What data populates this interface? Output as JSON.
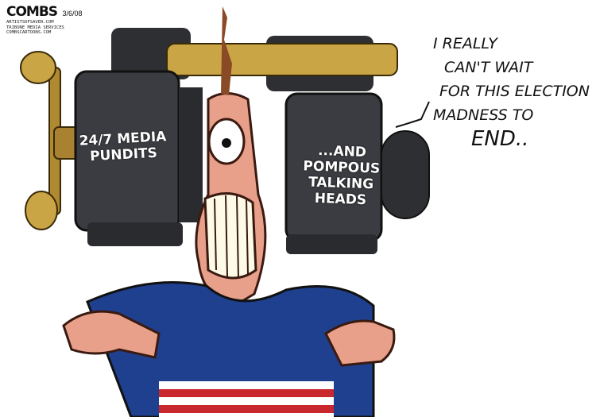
{
  "signature": {
    "name": "COMBS",
    "date": "3/6/08",
    "lines": [
      "ARTISTSOFSAVER.COM",
      "TRIBUNE MEDIA SERVICES",
      "COMBSCARTOONS.COM"
    ]
  },
  "vise": {
    "left_jaw_text": "24/7 MEDIA PUNDITS",
    "right_jaw_text": "...AND POMPOUS TALKING HEADS"
  },
  "speech_bubble": {
    "lines": [
      "I REALLY",
      "CAN'T WAIT",
      "FOR THIS ELECTION",
      "MADNESS TO",
      "END.."
    ]
  },
  "colors": {
    "vise_dark": "#2e2f33",
    "vise_mid": "#4a4b50",
    "brass": "#c9a545",
    "skin": "#e8a08a",
    "shirt_blue": "#1f3f8f",
    "stripe_red": "#c8282d"
  }
}
